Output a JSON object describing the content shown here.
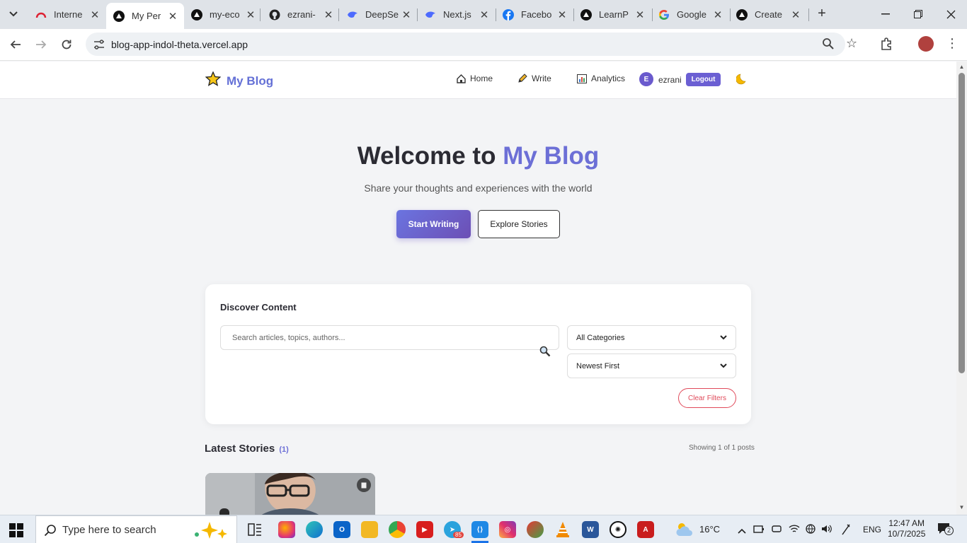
{
  "browser": {
    "tabs": [
      {
        "label": "Interne",
        "icon": "wifi-arc-icon"
      },
      {
        "label": "My Per",
        "icon": "vercel-icon",
        "active": true
      },
      {
        "label": "my-eco",
        "icon": "vercel-icon"
      },
      {
        "label": "ezrani-",
        "icon": "github-icon"
      },
      {
        "label": "DeepSe",
        "icon": "deepseek-icon"
      },
      {
        "label": "Next.js",
        "icon": "deepseek-icon"
      },
      {
        "label": "Facebo",
        "icon": "facebook-icon"
      },
      {
        "label": "LearnP",
        "icon": "vercel-icon"
      },
      {
        "label": "Google",
        "icon": "google-icon"
      },
      {
        "label": "Create",
        "icon": "vercel-icon"
      }
    ],
    "url": "blog-app-indol-theta.vercel.app"
  },
  "site": {
    "brand": "My Blog",
    "nav": {
      "home": "Home",
      "write": "Write",
      "analytics": "Analytics"
    },
    "user": {
      "initial": "E",
      "name": "ezrani"
    },
    "logout": "Logout"
  },
  "hero": {
    "title_prefix": "Welcome to",
    "title_accent": "My Blog",
    "subtitle": "Share your thoughts and experiences with the world",
    "primary_cta": "Start Writing",
    "secondary_cta": "Explore Stories"
  },
  "filters": {
    "title": "Discover Content",
    "search_placeholder": "Search articles, topics, authors...",
    "category_selected": "All Categories",
    "sort_selected": "Newest First",
    "clear": "Clear Filters"
  },
  "latest": {
    "title": "Latest Stories",
    "count": "(1)",
    "showing": "Showing 1 of 1 posts"
  },
  "taskbar": {
    "search_placeholder": "Type here to search",
    "telegram_badge": "85",
    "temperature": "16°C",
    "language": "ENG",
    "time": "12:47 AM",
    "date": "10/7/2025",
    "notifications": "2"
  },
  "colors": {
    "accent": "#6c6fd6",
    "logout": "#6b5fd3",
    "danger": "#e04a5a"
  }
}
